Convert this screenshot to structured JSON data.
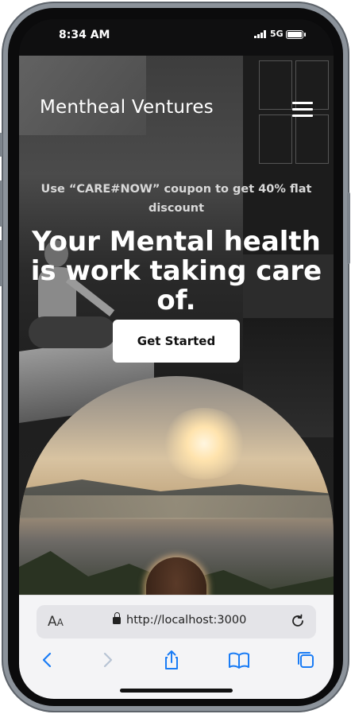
{
  "status": {
    "time": "8:34 AM",
    "network": "5G"
  },
  "nav": {
    "brand": "Mentheal Ventures",
    "menu_icon": "hamburger-menu-icon"
  },
  "hero": {
    "coupon": "Use “CARE#NOW” coupon to get 40% flat discount",
    "headline": "Your Mental health is work taking care of.",
    "cta": "Get Started"
  },
  "browser": {
    "text_size_label": "AA",
    "url": "http://localhost:3000",
    "icons": [
      "text-size-icon",
      "lock-icon",
      "reload-icon",
      "back-icon",
      "forward-icon",
      "share-icon",
      "bookmarks-icon",
      "tabs-icon"
    ],
    "accent": "#1a7cf5"
  }
}
